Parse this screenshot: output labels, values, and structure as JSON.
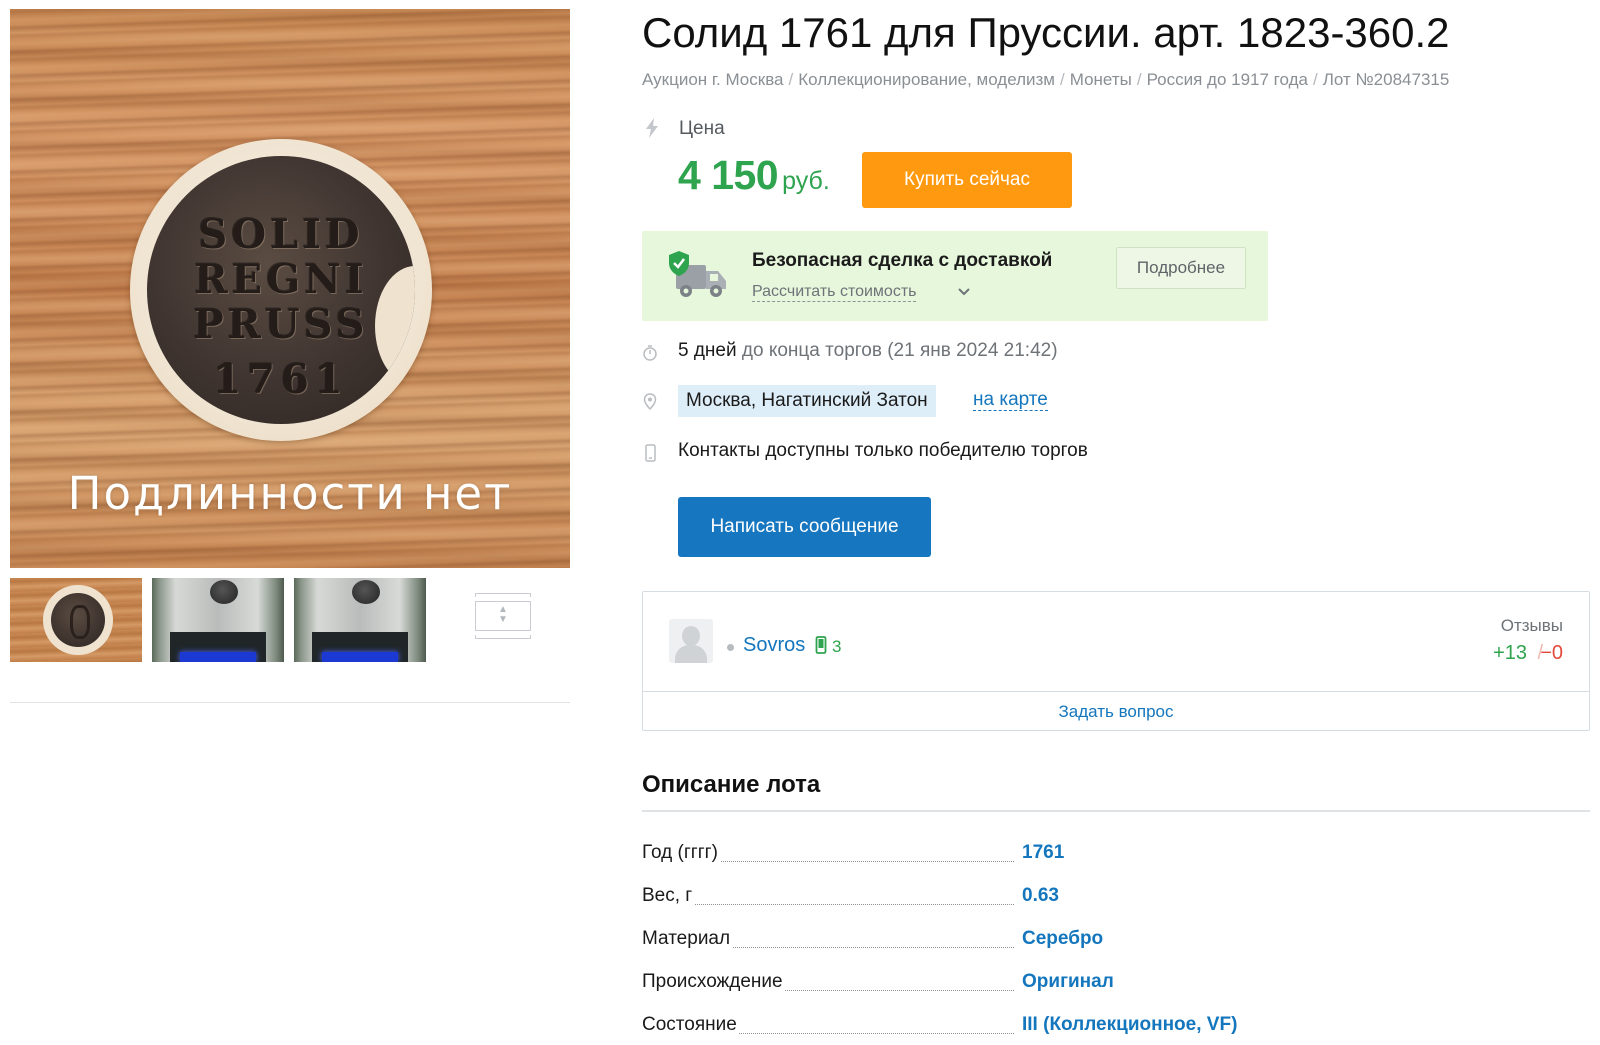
{
  "listing": {
    "title": "Солид 1761 для Пруссии. арт. 1823-360.2",
    "photo_watermark": "Подлинности нет",
    "coin_inscription": [
      "SOLID",
      "REGNI",
      "PRUSS",
      "1761"
    ]
  },
  "breadcrumb": {
    "items": [
      "Аукцион г. Москва",
      "Коллекционирование, моделизм",
      "Монеты",
      "Россия до 1917 года",
      "Лот №20847315"
    ],
    "separator": "/"
  },
  "price": {
    "label": "Цена",
    "amount": "4 150",
    "currency": "руб.",
    "buy_button": "Купить сейчас"
  },
  "safe_deal": {
    "title": "Безопасная сделка с доставкой",
    "calc_link": "Рассчитать стоимость",
    "more_button": "Подробнее"
  },
  "auction": {
    "time_left": "5 дней",
    "time_suffix": "до конца торгов",
    "end_date": "(21 янв 2024 21:42)",
    "location": "Москва, Нагатинский Затон",
    "map_link": "на карте",
    "contacts_note": "Контакты доступны только победителю торгов",
    "message_button": "Написать сообщение"
  },
  "seller": {
    "name": "Sovros",
    "verified_count": "3",
    "reviews_label": "Отзывы",
    "reviews_positive": "+13",
    "reviews_separator": "/",
    "reviews_negative": "−0",
    "ask_question": "Задать вопрос"
  },
  "description": {
    "title": "Описание лота",
    "specs": [
      {
        "key": "Год (гггг)",
        "value": "1761"
      },
      {
        "key": "Вес, г",
        "value": "0.63"
      },
      {
        "key": "Материал",
        "value": "Серебро"
      },
      {
        "key": "Происхождение",
        "value": "Оригинал"
      },
      {
        "key": "Состояние",
        "value": "III (Коллекционное, VF)"
      }
    ]
  },
  "colors": {
    "price_green": "#2ea44f",
    "buy_orange": "#ff9a10",
    "link_blue": "#1476bd",
    "message_blue": "#1676bf",
    "safe_deal_bg": "#e7f7dc"
  }
}
